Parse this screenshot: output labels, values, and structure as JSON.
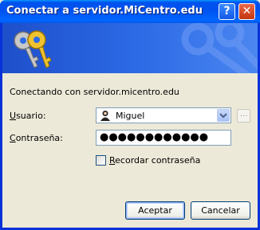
{
  "window": {
    "title": "Conectar a servidor.MiCentro.edu",
    "help_glyph": "?",
    "close_glyph": "✕"
  },
  "message": "Conectando con servidor.micentro.edu",
  "form": {
    "user_label_key": "U",
    "user_label_rest": "suario:",
    "user_value": "Miguel",
    "browse_glyph": "...",
    "password_label_key": "C",
    "password_label_rest": "ontraseña:",
    "password_value": "●●●●●●●●●●●●",
    "remember_key": "R",
    "remember_rest": "ecordar contraseña",
    "remember_checked": false
  },
  "buttons": {
    "ok": "Aceptar",
    "cancel": "Cancelar"
  },
  "icons": {
    "banner": "keys-icon",
    "user": "user-icon",
    "dropdown": "chevron-down-icon"
  },
  "colors": {
    "title_bar": "#0053ee",
    "banner": "#2d6be6",
    "client": "#ece9d8",
    "button_border": "#003c74"
  }
}
